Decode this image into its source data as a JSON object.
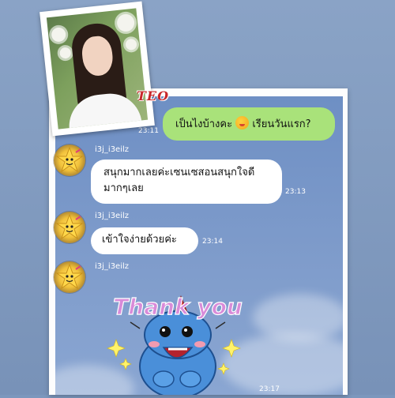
{
  "logo_text": "TEO",
  "outgoing": {
    "time": "23:11",
    "text_before": "เป็นไงบ้างคะ",
    "text_after": "เรียนวันแรก?"
  },
  "messages": [
    {
      "sender": "i3j_i3eilz",
      "line1": "สนุกมากเลยค่ะเซนเซสอนสนุกใจดี",
      "line2": "มากๆเลย",
      "time": "23:13"
    },
    {
      "sender": "i3j_i3eilz",
      "line1": "เข้าใจง่ายด้วยค่ะ",
      "time": "23:14"
    },
    {
      "sender": "i3j_i3eilz",
      "sticker_text": "Thank you",
      "time": "23:17"
    }
  ],
  "colors": {
    "outgoing_bubble": "#a9e27a",
    "incoming_bubble": "#ffffff",
    "chat_background": "#7f9ccb",
    "logo": "#c8262a"
  },
  "icons": [
    "grinning-face-emoji-icon",
    "star-avatar-icon",
    "dinosaur-sticker-icon"
  ]
}
